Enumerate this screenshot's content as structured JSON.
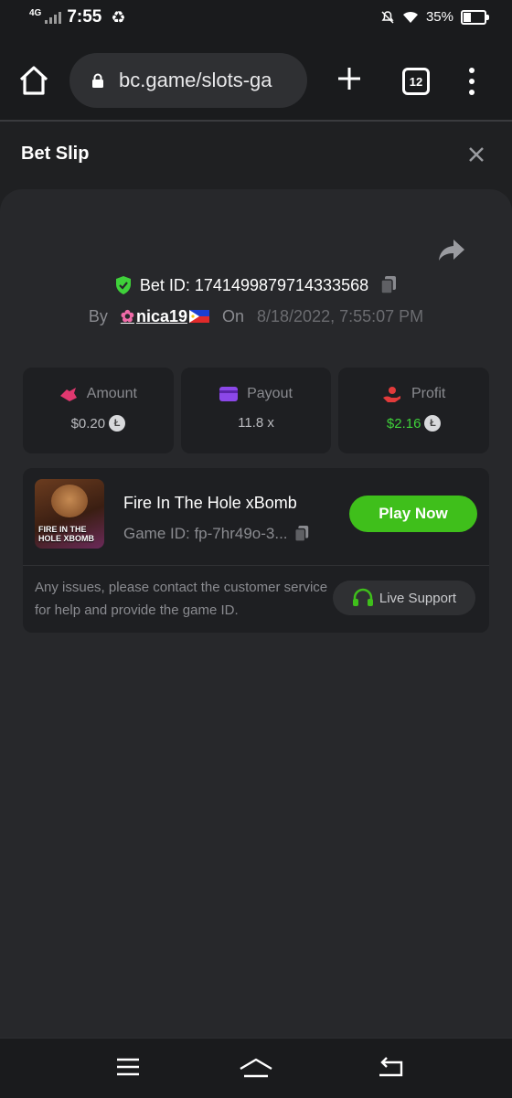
{
  "status_bar": {
    "network": "4G",
    "time": "7:55",
    "battery": "35%",
    "battery_level": 0.35
  },
  "browser": {
    "url": "bc.game/slots-ga",
    "tab_count": "12"
  },
  "bet_slip": {
    "title": "Bet Slip",
    "bet_id_label": "Bet ID: 1741499879714333568",
    "by_label": "By",
    "username": "nica19",
    "on_label": "On",
    "datetime": "8/18/2022, 7:55:07 PM"
  },
  "stats": {
    "amount_label": "Amount",
    "amount_value": "$0.20",
    "payout_label": "Payout",
    "payout_value": "11.8 x",
    "profit_label": "Profit",
    "profit_value": "$2.16"
  },
  "game": {
    "title": "Fire In The Hole xBomb",
    "game_id": "Game ID: fp-7hr49o-3...",
    "thumb_text_1": "FIRE IN THE",
    "thumb_text_2": "HOLE XBOMB",
    "play_label": "Play Now",
    "issue_text": "Any issues, please contact the customer service for help and provide the game ID.",
    "live_support_label": "Live Support"
  },
  "colors": {
    "accent_green": "#3fbf1b",
    "profit_green": "#3fd13a",
    "amount_pink": "#e0386f",
    "payout_purple": "#8b47e8",
    "profit_red": "#e23b3b"
  }
}
